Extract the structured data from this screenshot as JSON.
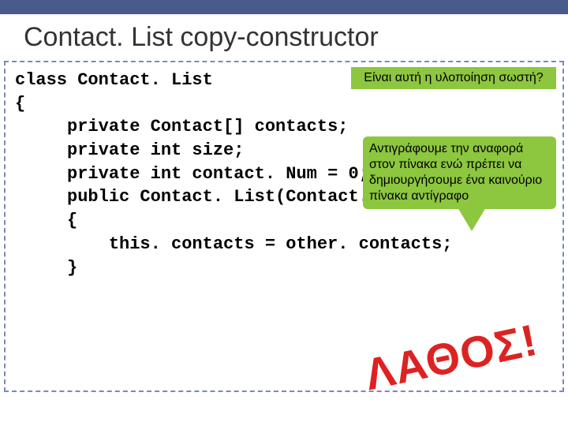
{
  "title": "Contact. List copy-constructor",
  "code": {
    "l1": "class Contact. List",
    "l2": "{",
    "l3": "     private Contact[] contacts;",
    "l4": "     private int size;",
    "l5": "     private int contact. Num = 0;",
    "l6": "",
    "l7": "     public Contact. List(Contact. List other)",
    "l8": "     {",
    "l9": "         this. contacts = other. contacts;",
    "l10": "     }"
  },
  "callouts": {
    "c1": "Είναι αυτή η υλοποίηση σωστή?",
    "c2": "Αντιγράφουμε την αναφορά στον πίνακα ενώ πρέπει να δημιουργήσουμε ένα καινούριο πίνακα αντίγραφο"
  },
  "stamp": "ΛΑΘΟΣ!"
}
